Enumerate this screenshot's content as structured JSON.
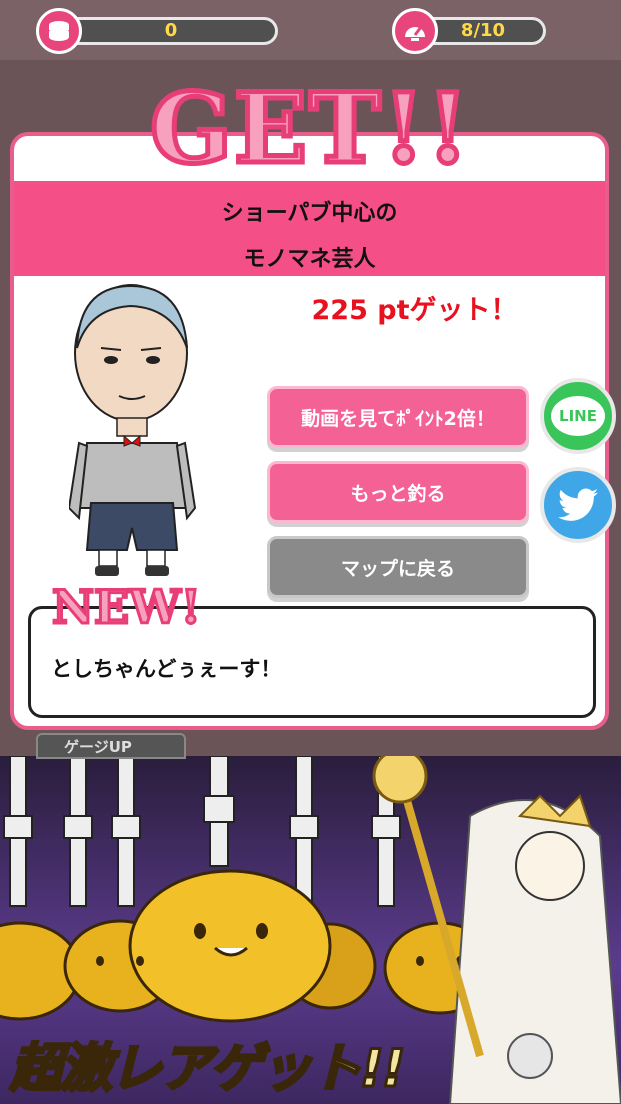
{
  "header": {
    "coins_value": "0",
    "stamina_value": "8/10"
  },
  "dialog": {
    "banner_title": "GET!!",
    "item_name_line1": "ショーパブ中心の",
    "item_name_line2": "モノマネ芸人",
    "points_text": "225 ptゲット！",
    "new_badge": "NEW!",
    "speech_text": "としちゃんどぅぇーす！"
  },
  "buttons": {
    "double_points_label": "動画を見てﾎﾟｲﾝﾄ2倍！",
    "fish_again_label": "もっと釣る",
    "back_to_map_label": "マップに戻る"
  },
  "social": {
    "line_label": "LINE"
  },
  "background": {
    "gauge_tab_label": "ゲージUP"
  },
  "ad": {
    "headline": "超激レアゲット!!"
  },
  "colors": {
    "accent_pink": "#f44f86",
    "line_green": "#3ac55a",
    "twitter_blue": "#3fa7e8",
    "points_red": "#e8111f"
  }
}
